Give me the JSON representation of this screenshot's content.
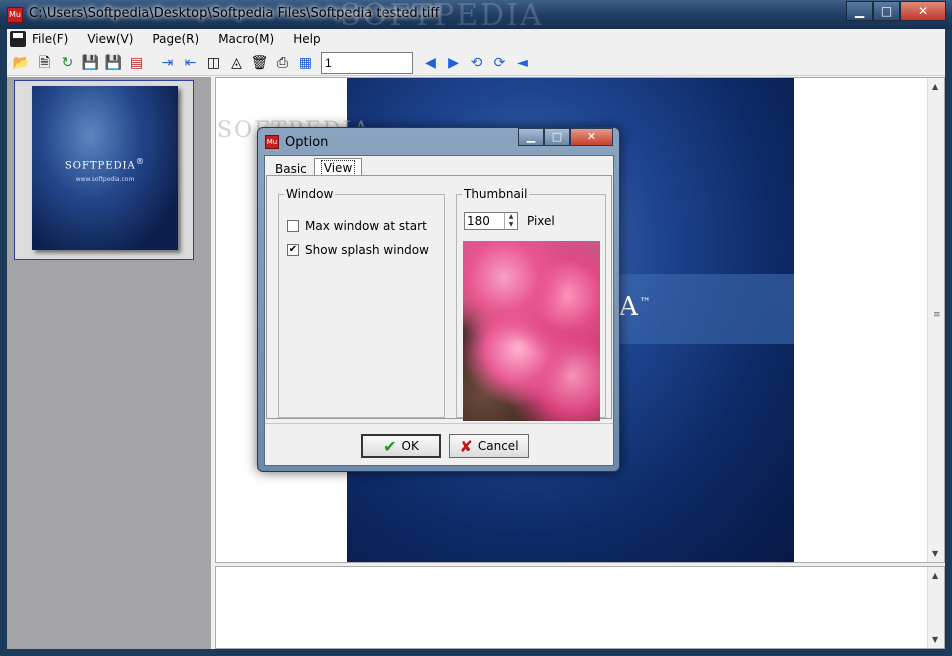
{
  "window": {
    "title": "C:\\Users\\Softpedia\\Desktop\\Softpedia Files\\Softpedia tested.tiff",
    "watermark": "SOFTPEDIA",
    "app_icon_text": "Mu",
    "controls": {
      "minimize": "▁",
      "maximize": "□",
      "close": "✕"
    }
  },
  "menubar": {
    "items": [
      "File(F)",
      "View(V)",
      "Page(R)",
      "Macro(M)",
      "Help"
    ]
  },
  "toolbar": {
    "page_value": "1",
    "icons": [
      "open-folder-icon",
      "properties-icon",
      "refresh-icon",
      "save-icon",
      "save-as-icon",
      "pdf-icon",
      "insert-page-icon",
      "extract-page-icon",
      "split-icon",
      "merge-icon",
      "delete-icon",
      "print-icon",
      "scan-icon",
      "previous-page-icon",
      "next-page-icon",
      "rotate-left-icon",
      "rotate-right-icon",
      "flip-icon"
    ]
  },
  "thumbnail": {
    "brand": "SOFTPEDIA",
    "tm": "®",
    "sub": "www.softpedia.com"
  },
  "document": {
    "watermark": "SOFTPEDIA",
    "brand_fragment": "A",
    "tm": "™"
  },
  "dialog": {
    "title": "Option",
    "icon_text": "Mu",
    "tabs": [
      {
        "label": "Basic",
        "active": false
      },
      {
        "label": "View",
        "active": true
      }
    ],
    "window_group": {
      "legend": "Window",
      "options": [
        {
          "label": "Max window at start",
          "checked": false
        },
        {
          "label": "Show splash window",
          "checked": true
        }
      ]
    },
    "thumbnail_group": {
      "legend": "Thumbnail",
      "size_value": "180",
      "unit_label": "Pixel"
    },
    "buttons": {
      "ok": "OK",
      "cancel": "Cancel"
    }
  }
}
